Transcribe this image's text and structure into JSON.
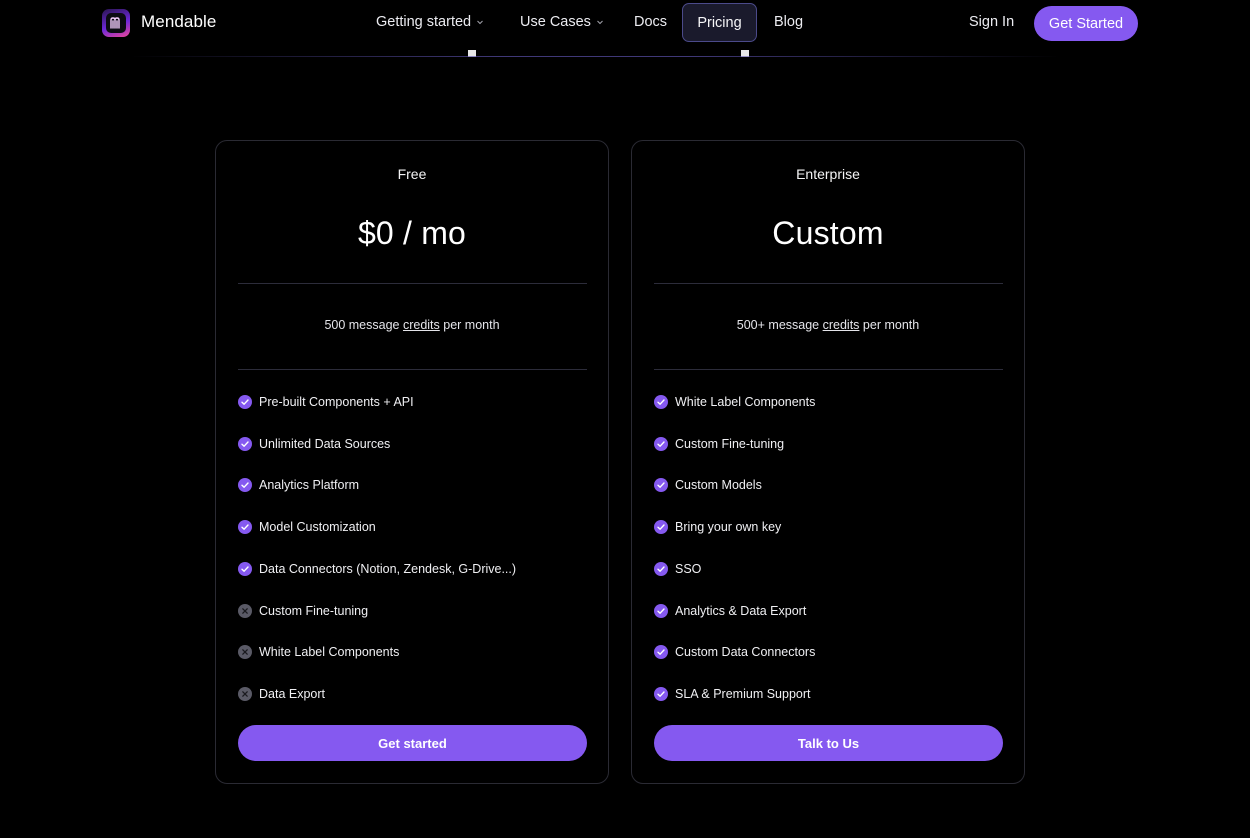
{
  "brand": {
    "name": "Mendable",
    "accent_color": "#8559f0"
  },
  "nav": {
    "links": [
      {
        "label": "Getting started",
        "has_dropdown": true
      },
      {
        "label": "Use Cases",
        "has_dropdown": true
      },
      {
        "label": "Docs",
        "has_dropdown": false
      },
      {
        "label": "Pricing",
        "active": true
      },
      {
        "label": "Blog",
        "has_dropdown": false
      }
    ],
    "sign_in": "Sign In",
    "get_started": "Get Started"
  },
  "plans": [
    {
      "name": "Free",
      "price": "$0 / mo",
      "credits_prefix": "500 message ",
      "credits_link": "credits",
      "credits_suffix": " per month",
      "features": [
        {
          "label": "Pre-built Components + API",
          "included": true
        },
        {
          "label": "Unlimited Data Sources",
          "included": true
        },
        {
          "label": "Analytics Platform",
          "included": true
        },
        {
          "label": "Model Customization",
          "included": true
        },
        {
          "label": "Data Connectors (Notion, Zendesk, G-Drive...)",
          "included": true
        },
        {
          "label": "Custom Fine-tuning",
          "included": false
        },
        {
          "label": "White Label Components",
          "included": false
        },
        {
          "label": "Data Export",
          "included": false
        }
      ],
      "cta": "Get started"
    },
    {
      "name": "Enterprise",
      "price": "Custom",
      "credits_prefix": "500+ message ",
      "credits_link": "credits",
      "credits_suffix": " per month",
      "features": [
        {
          "label": "White Label Components",
          "included": true
        },
        {
          "label": "Custom Fine-tuning",
          "included": true
        },
        {
          "label": "Custom Models",
          "included": true
        },
        {
          "label": "Bring your own key",
          "included": true
        },
        {
          "label": "SSO",
          "included": true
        },
        {
          "label": "Analytics & Data Export",
          "included": true
        },
        {
          "label": "Custom Data Connectors",
          "included": true
        },
        {
          "label": "SLA & Premium Support",
          "included": true
        }
      ],
      "cta": "Talk to Us"
    }
  ],
  "icons": {
    "included": "check-circle-icon",
    "excluded": "x-circle-icon"
  }
}
